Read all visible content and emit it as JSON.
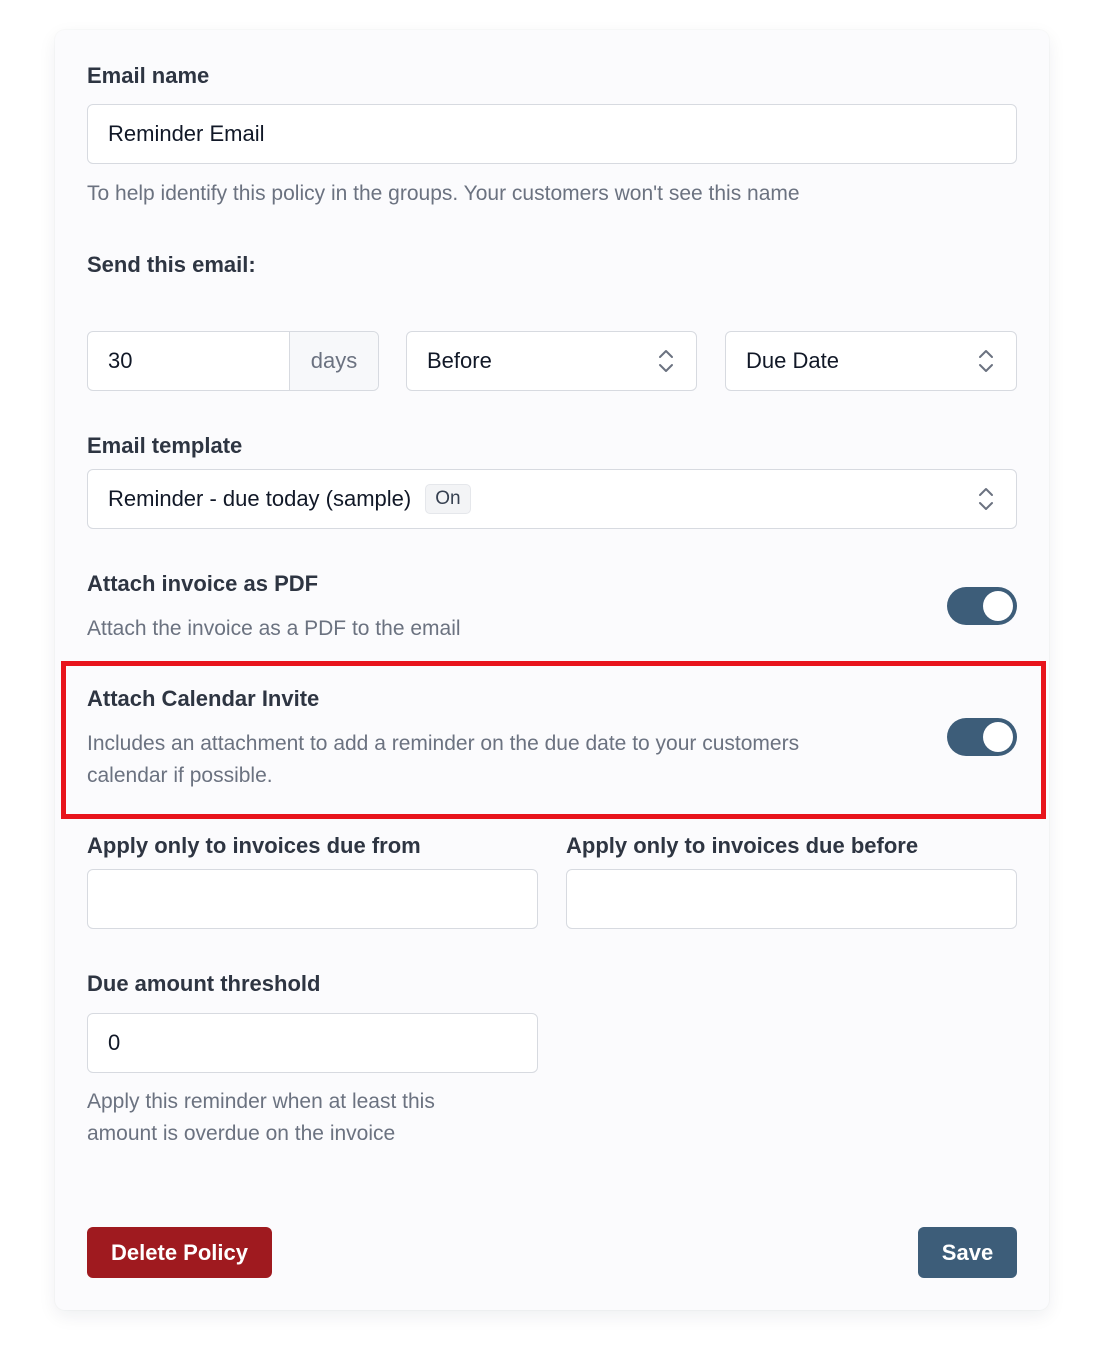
{
  "email_name": {
    "label": "Email name",
    "value": "Reminder Email",
    "help": "To help identify this policy in the groups. Your customers won't see this name"
  },
  "send": {
    "label": "Send this email:",
    "days_value": "30",
    "days_addon": "days",
    "timing_selected": "Before",
    "reference_selected": "Due Date"
  },
  "template": {
    "label": "Email template",
    "selected": "Reminder - due today (sample)",
    "badge": "On"
  },
  "attach_pdf": {
    "label": "Attach invoice as PDF",
    "help": "Attach the invoice as a PDF to the email",
    "enabled": true
  },
  "attach_calendar": {
    "label": "Attach Calendar Invite",
    "help_line1": "Includes an attachment to add a reminder on the due date to your customers",
    "help_line2": "calendar if possible.",
    "enabled": true
  },
  "due_from": {
    "label": "Apply only to invoices due from",
    "value": ""
  },
  "due_before": {
    "label": "Apply only to invoices due before",
    "value": ""
  },
  "threshold": {
    "label": "Due amount threshold",
    "value": "0",
    "help_line1": "Apply this reminder when at least this",
    "help_line2": "amount is overdue on the invoice"
  },
  "actions": {
    "delete_label": "Delete Policy",
    "save_label": "Save"
  },
  "colors": {
    "toggle_on": "#3d5d79",
    "delete": "#9f1a1f",
    "save": "#3d5d79",
    "highlight": "#e8141c"
  }
}
